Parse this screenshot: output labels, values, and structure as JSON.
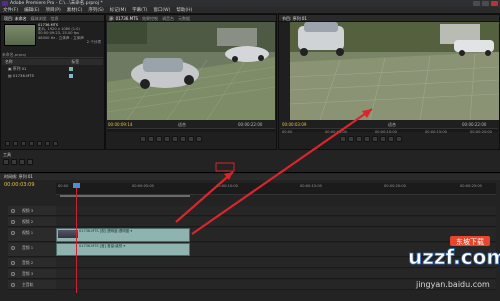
{
  "window": {
    "title": "Adobe Premiere Pro - C:\\...\\未命名.prproj *"
  },
  "menu": [
    "文件(F)",
    "编辑(E)",
    "项目(P)",
    "素材(C)",
    "序列(S)",
    "标记(M)",
    "字幕(T)",
    "窗口(W)",
    "帮助(H)"
  ],
  "project_panel": {
    "tabs": [
      "项目: 未命名",
      "媒体浏览",
      "信息"
    ],
    "selected_clip": "01736.MTS",
    "info_lines": [
      "影片, 1920 x 1080 (1.0)",
      "00:00:09:23, 25.00 fps",
      "48000 Hz - 立体声 - 立体声"
    ],
    "count": "2 个分项",
    "project_name": "未命名.prproj",
    "column_name": "名称",
    "column_label": "标签",
    "items": [
      {
        "name": "序列 01",
        "color": "#7fb8a0"
      },
      {
        "name": "01736.MTS",
        "color": "#7fb8d8"
      }
    ]
  },
  "source_panel": {
    "tabs": [
      "源: 01736.MTS",
      "效果控制",
      "调音台",
      "元数据"
    ],
    "timecode": "00:00:09:14",
    "ruler_start": "00:00",
    "ruler_end": "00:00:05:00",
    "fit": "适合",
    "duration": "00:00:22:00"
  },
  "program_panel": {
    "tab": "节目: 序列 01",
    "timecode": "00:00:03:09",
    "fit": "适合",
    "duration": "00:00:22:00",
    "ruler_labels": [
      "00:00",
      "00:00:05:00",
      "00:00:10:00",
      "00:00:15:00",
      "00:00:20:00"
    ]
  },
  "tools_panel": {
    "tab": "工具"
  },
  "timeline": {
    "tab": "时间线: 序列 01",
    "timecode": "00:00:03:09",
    "ruler_labels": [
      "00:00",
      "00:00:05:00",
      "00:00:10:00",
      "00:00:15:00",
      "00:00:20:00",
      "00:00:25:00"
    ],
    "video_tracks": [
      "视频 3",
      "视频 2",
      "视频 1"
    ],
    "audio_tracks": [
      "音频 1",
      "音频 2",
      "音频 3",
      "主音轨"
    ],
    "clip_video_label": "01736.MTS [视] 透明度:透明度 ▾",
    "clip_audio_label": "01736.MTS [音] 音量:级别 ▾",
    "clip_small_label": "01736.MTS"
  },
  "watermark": {
    "logo_text": "uzzf.com",
    "badge": "东坡下载",
    "site": "jingyan.baidu.com"
  },
  "colors": {
    "accent": "#e6c23c",
    "clip": "#8fb4b0",
    "arrow": "#d8262b",
    "playhead": "#c23"
  }
}
